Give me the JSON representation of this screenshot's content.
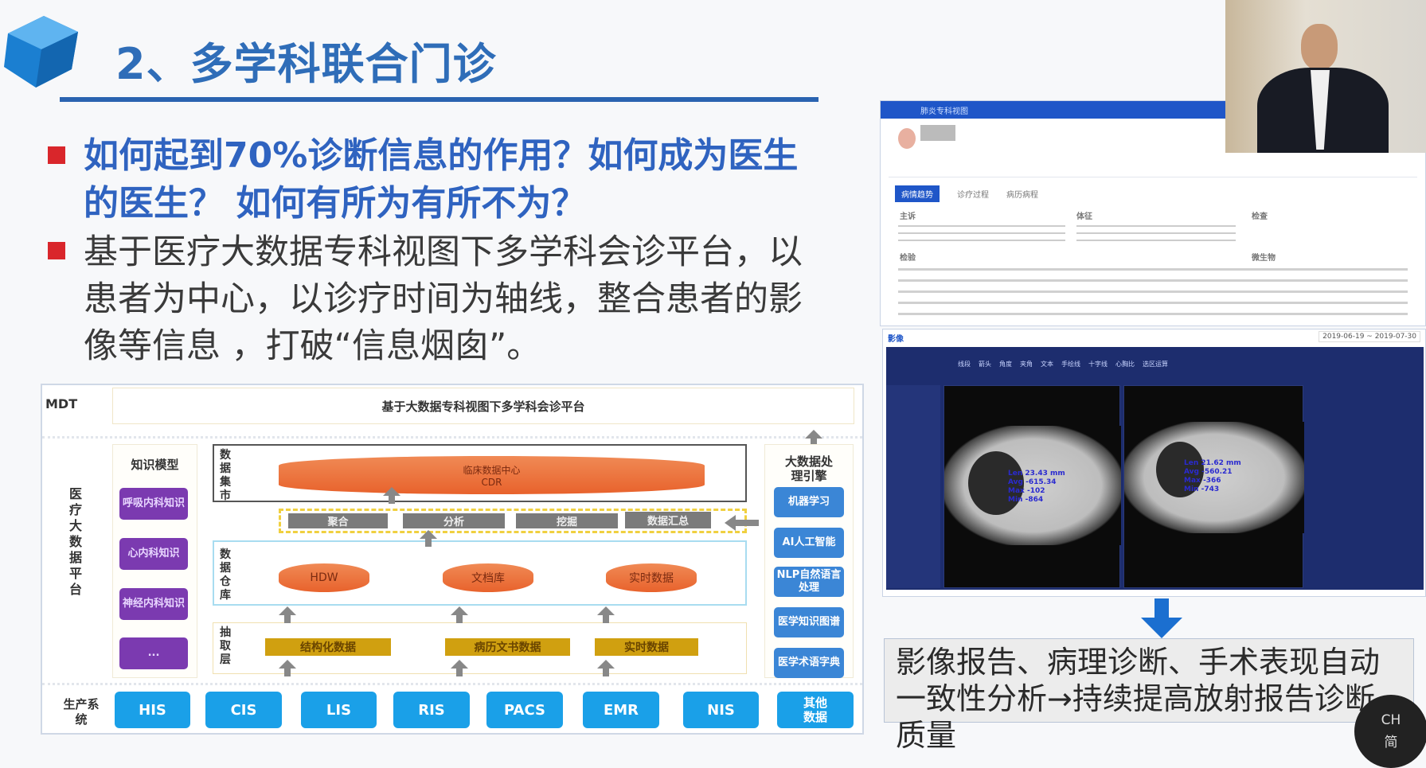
{
  "slide": {
    "title": "2、多学科联合门诊",
    "bullets": [
      "如何起到70%诊断信息的作用？如何成为医生的医生？ 如何有所为有所不为？",
      "基于医疗大数据专科视图下多学科会诊平台，以患者为中心，以诊疗时间为轴线，整合患者的影像等信息 ，打破“信息烟囱”。"
    ],
    "colors": {
      "title": "#2f6db8",
      "bullet_marker": "#d9262b",
      "rule": "#2a63b0"
    }
  },
  "diagram": {
    "mdt_label": "MDT",
    "mdt_title": "基于大数据专科视图下多学科会诊平台",
    "platform_label": "医疗大数据平台",
    "knowledge": {
      "title": "知识模型",
      "items": [
        "呼吸内科知识",
        "心内科知识",
        "神经内科知识",
        "..."
      ]
    },
    "mart": {
      "label": "数据集市",
      "cdr_line1": "临床数据中心",
      "cdr_line2": "CDR",
      "ops": [
        "聚合",
        "分析",
        "挖掘",
        "数据汇总"
      ]
    },
    "warehouse": {
      "label": "数据仓库",
      "items": [
        "HDW",
        "文档库",
        "实时数据"
      ]
    },
    "extract": {
      "label": "抽取层",
      "items": [
        "结构化数据",
        "病历文书数据",
        "实时数据"
      ]
    },
    "engine": {
      "title": "大数据处理引擎",
      "items": [
        "机器学习",
        "AI人工智能",
        "NLP自然语言处理",
        "医学知识图谱",
        "医学术语字典"
      ]
    },
    "production": {
      "label": "生产系统",
      "systems": [
        "HIS",
        "CIS",
        "LIS",
        "RIS",
        "PACS",
        "EMR",
        "NIS",
        "其他数据"
      ]
    }
  },
  "app_screenshot": {
    "header": "肺炎专科视图",
    "tabs": [
      "病情趋势",
      "诊疗过程",
      "病历病程"
    ],
    "sections": [
      "主诉",
      "体征",
      "检查",
      "检验",
      "微生物"
    ],
    "imaging_label": "影像",
    "date_range": "2019-06-19 ~ 2019-07-30",
    "toolbar": [
      "线段",
      "箭头",
      "角度",
      "夹角",
      "文本",
      "手绘线",
      "十字线",
      "心胸比",
      "选区运算"
    ],
    "measure_left": [
      "Len 23.43 mm",
      "Avg -615.34",
      "Max -102",
      "Min -864"
    ],
    "measure_right": [
      "Len 21.62 mm",
      "Avg -560.21",
      "Max -366",
      "Min -743"
    ]
  },
  "conclusion": "影像报告、病理诊断、手术表现自动一致性分析→持续提高放射报告诊断质量",
  "ime": {
    "lang": "CH",
    "mode": "简"
  }
}
